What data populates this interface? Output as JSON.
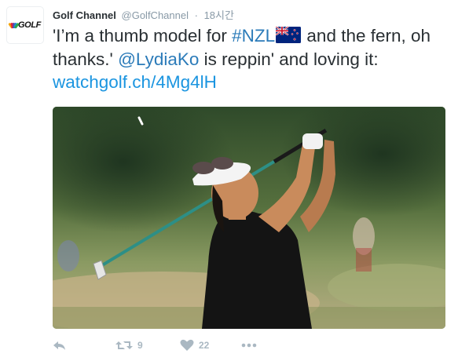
{
  "account": {
    "name": "Golf Channel",
    "handle": "@GolfChannel",
    "separator": "·",
    "time": "18시간",
    "avatar_text": "GOLF",
    "avatar_icon": "nbc-peacock-icon"
  },
  "tweet": {
    "part1": "'I’m a thumb model for ",
    "hashtag": "#NZL",
    "flag_icon": "new-zealand-flag-icon",
    "part2": " and the fern, oh thanks.' ",
    "mention": "@LydiaKo",
    "part3": " is reppin' and loving it: ",
    "url": "watchgolf.ch/4Mg4lH"
  },
  "media": {
    "description_icon": "golfer-photo"
  },
  "actions": {
    "reply_icon": "reply-icon",
    "retweet_icon": "retweet-icon",
    "retweet_count": "9",
    "like_icon": "heart-icon",
    "like_count": "22",
    "more_icon": "more-icon"
  },
  "colors": {
    "link": "#2b7bb9",
    "url": "#1b95e0",
    "muted": "#8899a6",
    "action_gray": "#aab8c2",
    "text": "#292f33"
  }
}
